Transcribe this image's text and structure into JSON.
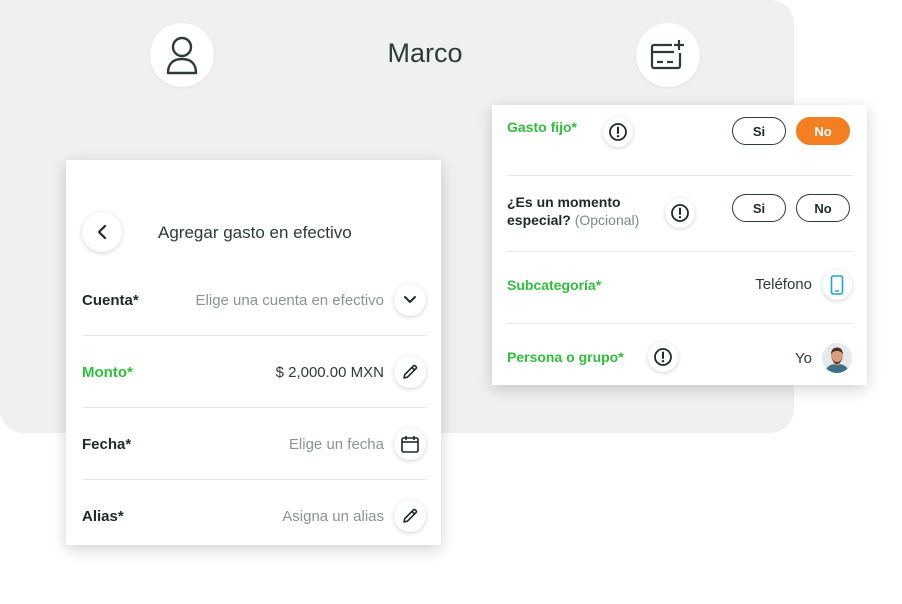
{
  "header": {
    "user_name": "Marco",
    "user_icon": "user-icon",
    "add_card_icon": "card-add-icon"
  },
  "left_panel": {
    "title": "Agregar gasto en efectivo",
    "back_icon": "chevron-left-icon",
    "rows": [
      {
        "label": "Cuenta*",
        "value": "Elige una cuenta en efectivo",
        "icon": "chevron-down-icon",
        "label_color": "dark",
        "value_style": "placeholder"
      },
      {
        "label": "Monto*",
        "value": "$ 2,000.00 MXN",
        "icon": "pencil-icon",
        "label_color": "green",
        "value_style": "filled"
      },
      {
        "label": "Fecha*",
        "value": "Elige un fecha",
        "icon": "calendar-icon",
        "label_color": "dark",
        "value_style": "placeholder"
      },
      {
        "label": "Alias*",
        "value": "Asigna un alias",
        "icon": "pencil-icon",
        "label_color": "dark",
        "value_style": "placeholder"
      }
    ]
  },
  "right_panel": {
    "gasto_fijo": {
      "label": "Gasto fijo*",
      "yes": "Si",
      "no": "No",
      "selected": "No"
    },
    "momento_especial": {
      "label_line1": "¿Es un momento",
      "label_line2": "especial?",
      "optional": "(Opcional)",
      "yes": "Si",
      "no": "No",
      "selected": ""
    },
    "subcategoria": {
      "label": "Subcategoría*",
      "value": "Teléfono",
      "icon": "phone-icon"
    },
    "persona": {
      "label": "Persona o grupo*",
      "value": "Yo",
      "icon": "avatar"
    }
  },
  "colors": {
    "green": "#2fbf3a",
    "orange": "#f47f20",
    "background_card": "#eef0f1",
    "text_dark": "#2d3a3a",
    "placeholder": "#8a9494"
  }
}
